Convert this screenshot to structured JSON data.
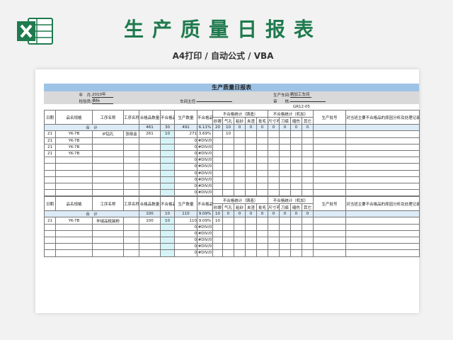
{
  "header": {
    "title": "生产质量日报表",
    "subtitle": "A4打印 / 自动公式 / VBA",
    "icon": "excel-icon",
    "accent": "#1f7a4e"
  },
  "sheet": {
    "banner": "生产质量日报表",
    "info": {
      "year_label": "年　月:",
      "year_value": "2010年",
      "inspector_label": "检验员:",
      "inspector_value": "费标",
      "supervisor_label": "车间主任:",
      "workshop_label": "生产车间:",
      "workshop_value": "精加工车间",
      "review_label": "审　　核:",
      "code": "GR12-05"
    },
    "headers": {
      "date": "日期",
      "product": "品名规格",
      "process": "工序名称",
      "worker": "工序名称",
      "qualified": "合格品数量",
      "unqualified": "不合格品数量",
      "production": "生产数量",
      "rate": "不合格品率",
      "casting": "不合格统计（铸造）",
      "machining": "不合格统计（机加）",
      "batch": "生产批号",
      "remarks": "对当班主要不合格品的原因分析及处理记录(简要)",
      "c1": "砂眼",
      "c2": "气孔",
      "c3": "粘砂",
      "c4": "夹渣",
      "c5": "批毛",
      "m1": "尺寸不良",
      "m2": "刀痕",
      "m3": "磕伤",
      "m4": "其它"
    },
    "table1": {
      "total": {
        "label": "合　计",
        "qualified": "461",
        "unqualified": "30",
        "production": "491",
        "rate": "6.11%",
        "c1": "20",
        "c2": "10",
        "c3": "0",
        "c4": "0",
        "c5": "0",
        "m1": "0",
        "m2": "0",
        "m3": "0",
        "m4": "0"
      },
      "rows": [
        {
          "date": "21",
          "product": "YK-7B",
          "process": "IP钻孔",
          "worker": "张晓金",
          "qualified": "261",
          "unqualified": "10",
          "production": "271",
          "rate": "3.69%",
          "c2": "10"
        },
        {
          "date": "21",
          "product": "YK-7B",
          "process": "",
          "worker": "",
          "qualified": "",
          "unqualified": "",
          "production": "0",
          "rate": "#DIV/0"
        },
        {
          "date": "21",
          "product": "YK-7B",
          "process": "",
          "worker": "",
          "qualified": "",
          "unqualified": "",
          "production": "0",
          "rate": "#DIV/0"
        },
        {
          "date": "21",
          "product": "YK-7B",
          "process": "",
          "worker": "",
          "qualified": "",
          "unqualified": "",
          "production": "0",
          "rate": "#DIV/0"
        },
        {
          "date": "",
          "product": "",
          "process": "",
          "worker": "",
          "qualified": "",
          "unqualified": "",
          "production": "0",
          "rate": "#DIV/0"
        },
        {
          "date": "",
          "product": "",
          "process": "",
          "worker": "",
          "qualified": "",
          "unqualified": "",
          "production": "0",
          "rate": "#DIV/0"
        },
        {
          "date": "",
          "product": "",
          "process": "",
          "worker": "",
          "qualified": "",
          "unqualified": "",
          "production": "0",
          "rate": "#DIV/0"
        },
        {
          "date": "",
          "product": "",
          "process": "",
          "worker": "",
          "qualified": "",
          "unqualified": "",
          "production": "0",
          "rate": "#DIV/0"
        },
        {
          "date": "",
          "product": "",
          "process": "",
          "worker": "",
          "qualified": "",
          "unqualified": "",
          "production": "0",
          "rate": "#DIV/0"
        },
        {
          "date": "",
          "product": "",
          "process": "",
          "worker": "",
          "qualified": "",
          "unqualified": "",
          "production": "0",
          "rate": "#DIV/0"
        }
      ]
    },
    "table2": {
      "total": {
        "label": "合　计",
        "qualified": "100",
        "unqualified": "10",
        "production": "110",
        "rate": "9.09%",
        "c1": "10",
        "c2": "0",
        "c3": "0",
        "c4": "0",
        "c5": "0",
        "m1": "0",
        "m2": "0",
        "m3": "0",
        "m4": "0"
      },
      "rows": [
        {
          "date": "21",
          "product": "YK-7B",
          "process": "羊绒品梳装粉",
          "worker": "",
          "qualified": "100",
          "unqualified": "10",
          "production": "110",
          "rate": "9.09%",
          "c1": "10"
        },
        {
          "date": "",
          "product": "",
          "process": "",
          "worker": "",
          "qualified": "",
          "unqualified": "",
          "production": "0",
          "rate": "#DIV/0"
        },
        {
          "date": "",
          "product": "",
          "process": "",
          "worker": "",
          "qualified": "",
          "unqualified": "",
          "production": "0",
          "rate": "#DIV/0"
        },
        {
          "date": "",
          "product": "",
          "process": "",
          "worker": "",
          "qualified": "",
          "unqualified": "",
          "production": "0",
          "rate": "#DIV/0"
        },
        {
          "date": "",
          "product": "",
          "process": "",
          "worker": "",
          "qualified": "",
          "unqualified": "",
          "production": "0",
          "rate": "#DIV/0"
        },
        {
          "date": "",
          "product": "",
          "process": "",
          "worker": "",
          "qualified": "",
          "unqualified": "",
          "production": "0",
          "rate": "#DIV/0"
        }
      ]
    }
  }
}
